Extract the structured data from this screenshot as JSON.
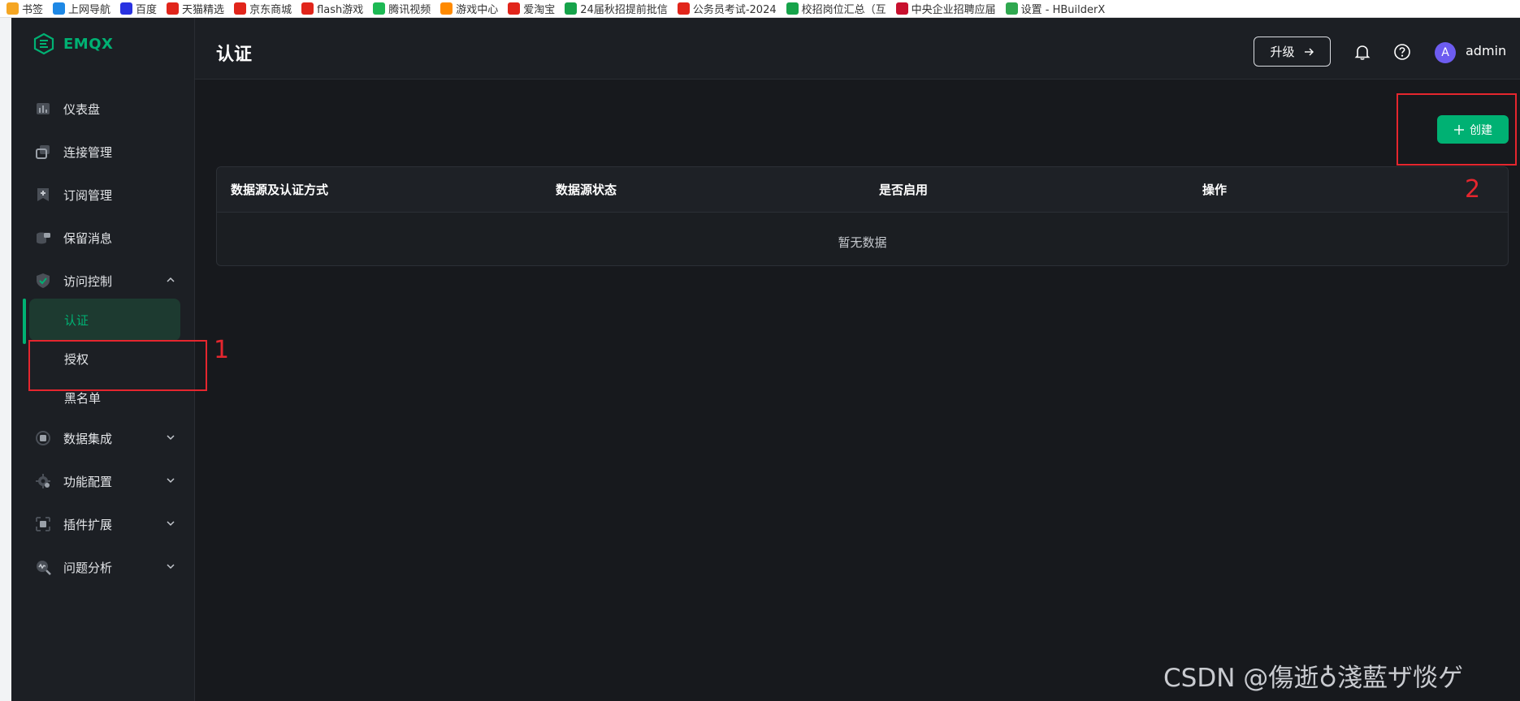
{
  "bookmarks": [
    {
      "label": "书签",
      "icon": "star-icon",
      "color": "#f5a623"
    },
    {
      "label": "上网导航",
      "icon": "ie-icon",
      "color": "#1e88e5"
    },
    {
      "label": "百度",
      "icon": "baidu-paw-icon",
      "color": "#2932e1"
    },
    {
      "label": "天猫精选",
      "icon": "tmall-icon",
      "color": "#e1251b"
    },
    {
      "label": "京东商城",
      "icon": "jd-icon",
      "color": "#e1251b"
    },
    {
      "label": "flash游戏",
      "icon": "flash-icon",
      "color": "#e1251b"
    },
    {
      "label": "腾讯视频",
      "icon": "tencent-video-icon",
      "color": "#1db954"
    },
    {
      "label": "游戏中心",
      "icon": "game-icon",
      "color": "#ff8a00"
    },
    {
      "label": "爱淘宝",
      "icon": "taobao-icon",
      "color": "#e1251b"
    },
    {
      "label": "24届秋招提前批信",
      "icon": "sheet-icon",
      "color": "#16a34a"
    },
    {
      "label": "公务员考试-2024",
      "icon": "exam-icon",
      "color": "#e1251b"
    },
    {
      "label": "校招岗位汇总（互",
      "icon": "sheet-icon",
      "color": "#16a34a"
    },
    {
      "label": "中央企业招聘应届",
      "icon": "soe-icon",
      "color": "#c8102e"
    },
    {
      "label": "设置 - HBuilderX",
      "icon": "hbuilder-icon",
      "color": "#2fa84f"
    }
  ],
  "app": {
    "name": "EMQX",
    "brand_color": "#00b173"
  },
  "sidebar": {
    "items": [
      {
        "label": "仪表盘",
        "icon": "dashboard-icon"
      },
      {
        "label": "连接管理",
        "icon": "connections-icon"
      },
      {
        "label": "订阅管理",
        "icon": "subscriptions-icon"
      },
      {
        "label": "保留消息",
        "icon": "retained-messages-icon"
      },
      {
        "label": "访问控制",
        "icon": "shield-icon",
        "expanded": true
      }
    ],
    "sub_items": [
      {
        "label": "认证",
        "active": true
      },
      {
        "label": "授权"
      },
      {
        "label": "黑名单"
      }
    ],
    "more_items": [
      {
        "label": "数据集成",
        "icon": "data-integration-icon"
      },
      {
        "label": "功能配置",
        "icon": "settings-gear-icon"
      },
      {
        "label": "插件扩展",
        "icon": "plugin-icon"
      },
      {
        "label": "问题分析",
        "icon": "diagnose-icon"
      }
    ]
  },
  "header": {
    "title": "认证",
    "upgrade_label": "升级",
    "username": "admin",
    "avatar_initial": "A"
  },
  "main": {
    "create_label": "创建",
    "columns": [
      "数据源及认证方式",
      "数据源状态",
      "是否启用",
      "操作"
    ],
    "empty_text": "暂无数据"
  },
  "annotations": {
    "box1": "1",
    "box2": "2"
  },
  "watermark": "CSDN @傷逝♁淺藍ザ惔ゲ"
}
